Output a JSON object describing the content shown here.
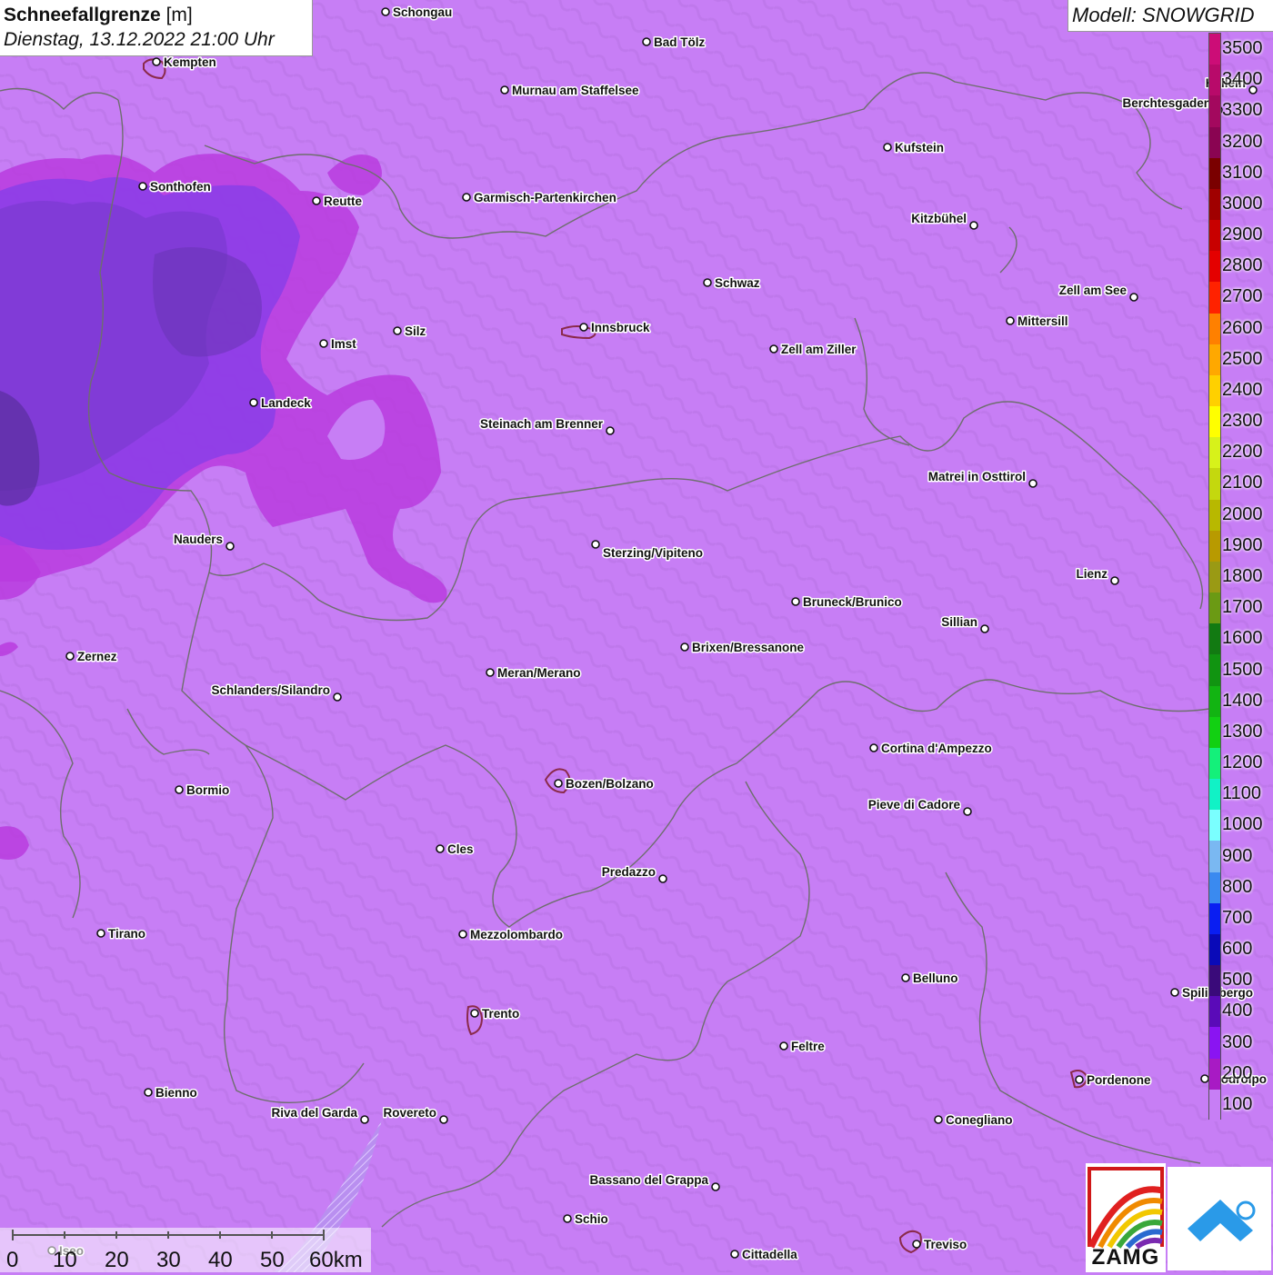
{
  "title": {
    "variable": "Schneefallgrenze",
    "unit": "[m]",
    "datetime": "Dienstag, 13.12.2022 21:00 Uhr"
  },
  "model": {
    "label": "Modell: SNOWGRID"
  },
  "legend": {
    "levels": [
      "3500",
      "3400",
      "3300",
      "3200",
      "3100",
      "3000",
      "2900",
      "2800",
      "2700",
      "2600",
      "2500",
      "2400",
      "2300",
      "2200",
      "2100",
      "2000",
      "1900",
      "1800",
      "1700",
      "1600",
      "1500",
      "1400",
      "1300",
      "1200",
      "1100",
      "1000",
      "900",
      "800",
      "700",
      "600",
      "500",
      "400",
      "300",
      "200",
      "100"
    ],
    "colors": [
      "#cc0d77",
      "#b80a6a",
      "#a3085e",
      "#8a0452",
      "#7a0000",
      "#a00000",
      "#c80000",
      "#e40000",
      "#ff2200",
      "#ff8000",
      "#ffa800",
      "#ffd000",
      "#ffff00",
      "#d7f21a",
      "#c4d80e",
      "#b8b800",
      "#b89a00",
      "#9a9a14",
      "#6b9a14",
      "#127a12",
      "#119411",
      "#12b412",
      "#12d012",
      "#14f07a",
      "#11f2c6",
      "#7affff",
      "#7ab8f2",
      "#3a8af0",
      "#0a1ef2",
      "#0a0ab8",
      "#3a0a7a",
      "#5a0ab8",
      "#8a14f2",
      "#a81ac4",
      "#c77ef5"
    ]
  },
  "cities": [
    {
      "name": "Schongau"
    },
    {
      "name": "Bad Tölz"
    },
    {
      "name": "Kempten"
    },
    {
      "name": "Murnau am Staffelsee"
    },
    {
      "name": "Hallein"
    },
    {
      "name": "Berchtesgaden"
    },
    {
      "name": "Kufstein"
    },
    {
      "name": "Sonthofen"
    },
    {
      "name": "Reutte"
    },
    {
      "name": "Garmisch-Partenkirchen"
    },
    {
      "name": "Kitzbühel"
    },
    {
      "name": "Schwaz"
    },
    {
      "name": "Zell am See"
    },
    {
      "name": "Innsbruck"
    },
    {
      "name": "Mittersill"
    },
    {
      "name": "Silz"
    },
    {
      "name": "Imst"
    },
    {
      "name": "Zell am Ziller"
    },
    {
      "name": "Landeck"
    },
    {
      "name": "Steinach am Brenner"
    },
    {
      "name": "Matrei in Osttirol"
    },
    {
      "name": "Nauders"
    },
    {
      "name": "Sterzing/Vipiteno"
    },
    {
      "name": "Lienz"
    },
    {
      "name": "Bruneck/Brunico"
    },
    {
      "name": "Sillian"
    },
    {
      "name": "Brixen/Bressanone"
    },
    {
      "name": "Zernez"
    },
    {
      "name": "Meran/Merano"
    },
    {
      "name": "Schlanders/Silandro"
    },
    {
      "name": "Cortina d'Ampezzo"
    },
    {
      "name": "Bozen/Bolzano"
    },
    {
      "name": "Bormio"
    },
    {
      "name": "Pieve di Cadore"
    },
    {
      "name": "Cles"
    },
    {
      "name": "Predazzo"
    },
    {
      "name": "Tirano"
    },
    {
      "name": "Mezzolombardo"
    },
    {
      "name": "Belluno"
    },
    {
      "name": "Spilimbergo"
    },
    {
      "name": "Trento"
    },
    {
      "name": "Feltre"
    },
    {
      "name": "Pordenone"
    },
    {
      "name": "Codroipo"
    },
    {
      "name": "Bienno"
    },
    {
      "name": "Riva del Garda"
    },
    {
      "name": "Rovereto"
    },
    {
      "name": "Conegliano"
    },
    {
      "name": "Bassano del Grappa"
    },
    {
      "name": "Schio"
    },
    {
      "name": "Iseo"
    },
    {
      "name": "Treviso"
    },
    {
      "name": "Cittadella"
    }
  ],
  "scalebar": {
    "ticks": [
      "0",
      "10",
      "20",
      "30",
      "40",
      "50",
      "60km"
    ]
  },
  "logos": {
    "zamg": "ZAMG",
    "snowgrid_icon": "snow-drop-icon"
  }
}
